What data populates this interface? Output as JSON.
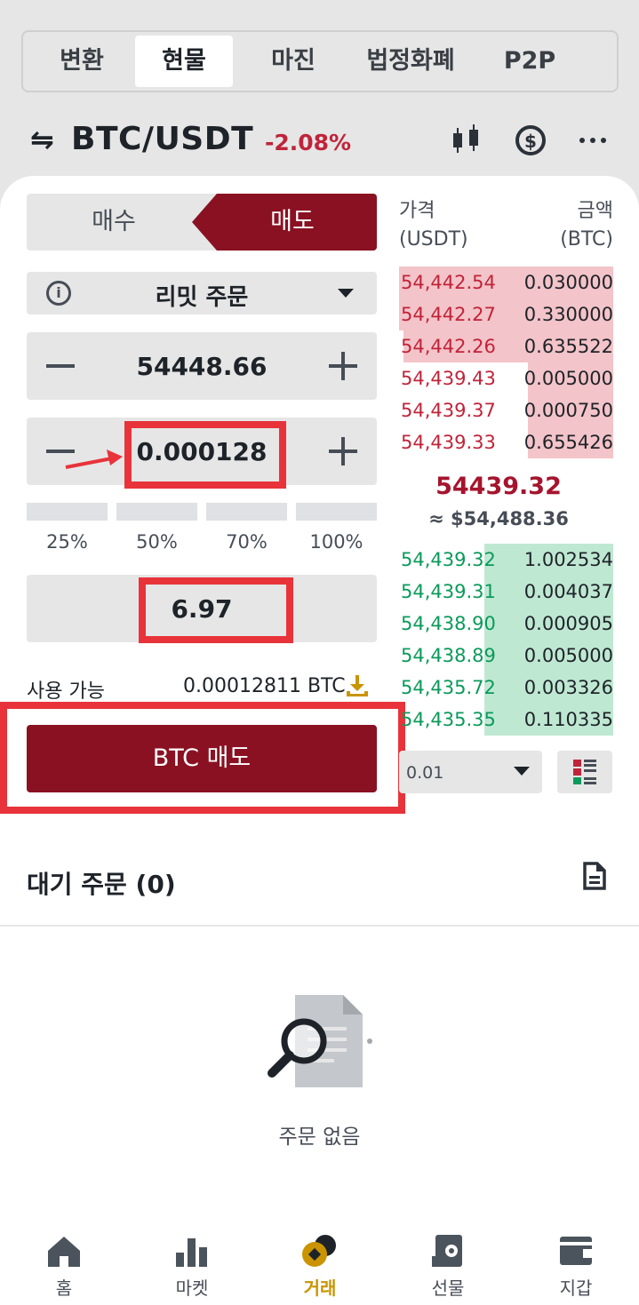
{
  "tabs": [
    "변환",
    "현물",
    "마진",
    "법정화폐",
    "P2P"
  ],
  "pair": {
    "name": "BTC/USDT",
    "change": "-2.08%"
  },
  "side": {
    "buy": "매수",
    "sell": "매도"
  },
  "order_type": "리밋 주문",
  "price": "54448.66",
  "amount": "0.000128",
  "percents": [
    "25%",
    "50%",
    "70%",
    "100%"
  ],
  "total": "6.97",
  "available": {
    "label": "사용 가능",
    "value": "0.00012811 BTC"
  },
  "sell_button": "BTC 매도",
  "orderbook": {
    "header_price": "가격",
    "header_price_unit": "(USDT)",
    "header_amount": "금액",
    "header_amount_unit": "(BTC)",
    "asks": [
      {
        "price": "54,442.54",
        "amount": "0.030000",
        "depth": 1.0
      },
      {
        "price": "54,442.27",
        "amount": "0.330000",
        "depth": 1.0
      },
      {
        "price": "54,442.26",
        "amount": "0.635522",
        "depth": 0.98
      },
      {
        "price": "54,439.43",
        "amount": "0.005000",
        "depth": 0.4
      },
      {
        "price": "54,439.37",
        "amount": "0.000750",
        "depth": 0.4
      },
      {
        "price": "54,439.33",
        "amount": "0.655426",
        "depth": 0.4
      }
    ],
    "mid_price": "54439.32",
    "mid_usd": "≈ $54,488.36",
    "bids": [
      {
        "price": "54,439.32",
        "amount": "1.002534",
        "depth": 0.6
      },
      {
        "price": "54,439.31",
        "amount": "0.004037",
        "depth": 0.6
      },
      {
        "price": "54,438.90",
        "amount": "0.000905",
        "depth": 0.6
      },
      {
        "price": "54,438.89",
        "amount": "0.005000",
        "depth": 0.6
      },
      {
        "price": "54,435.72",
        "amount": "0.003326",
        "depth": 0.6
      },
      {
        "price": "54,435.35",
        "amount": "0.110335",
        "depth": 0.6
      }
    ],
    "depth_select": "0.01"
  },
  "open_orders_title": "대기 주문 (0)",
  "empty_text": "주문 없음",
  "nav": [
    "홈",
    "마켓",
    "거래",
    "선물",
    "지갑"
  ],
  "colors": {
    "sell": "#8a1122",
    "ask": "#c0243a",
    "bid": "#0b9a5a",
    "active_nav": "#c99400",
    "highlight": "#e8333a"
  }
}
